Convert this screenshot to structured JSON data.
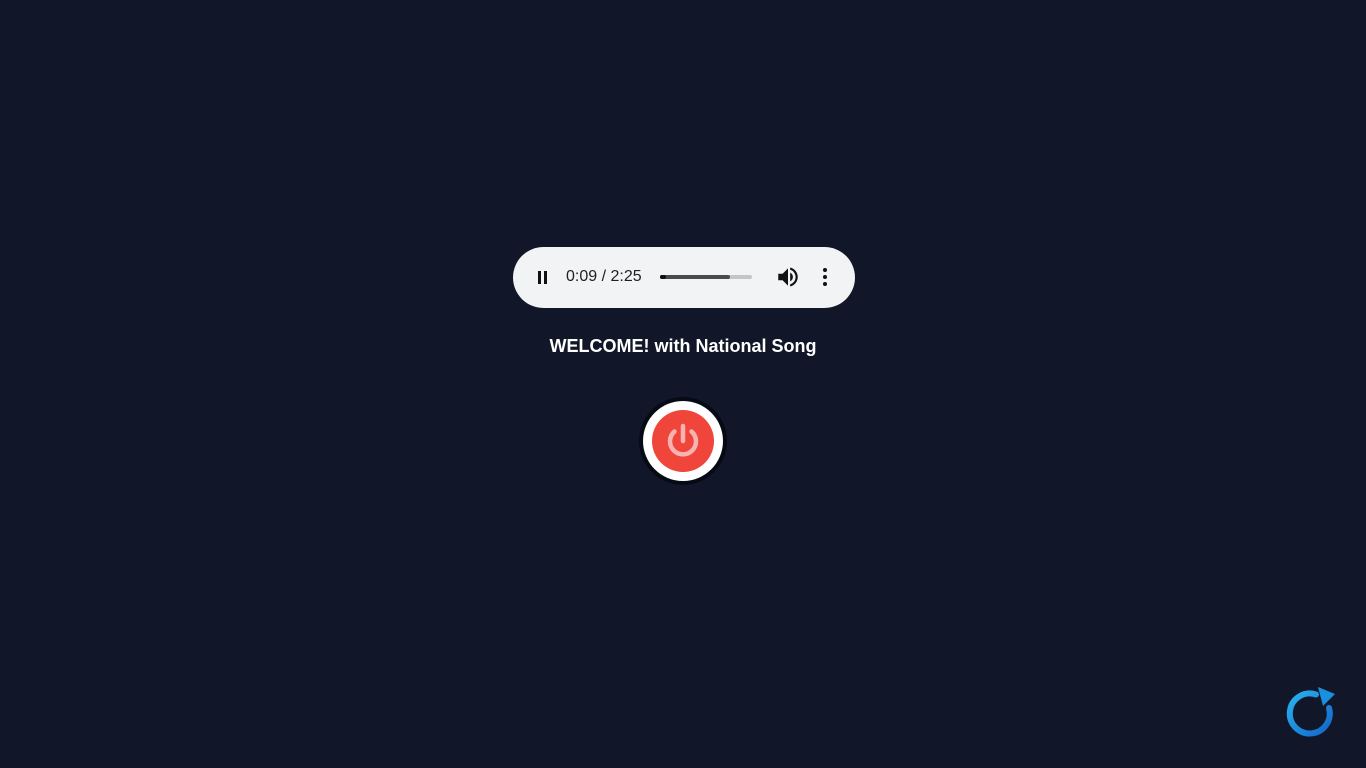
{
  "player": {
    "current_time": "0:09",
    "separator": " / ",
    "duration": "2:25",
    "progress_fraction": 0.062,
    "buffered_fraction": 0.76,
    "play_state_icon": "pause-icon",
    "volume_icon": "volume-icon",
    "menu_icon": "more-vertical-icon"
  },
  "welcome": {
    "text": "WELCOME! with National Song"
  },
  "power_button": {
    "icon": "power-icon",
    "color": "#f0453a"
  },
  "reload_button": {
    "icon": "reload-icon",
    "color": "#1a8fe0"
  },
  "colors": {
    "background": "#111729",
    "player_background": "#f1f3f4"
  }
}
